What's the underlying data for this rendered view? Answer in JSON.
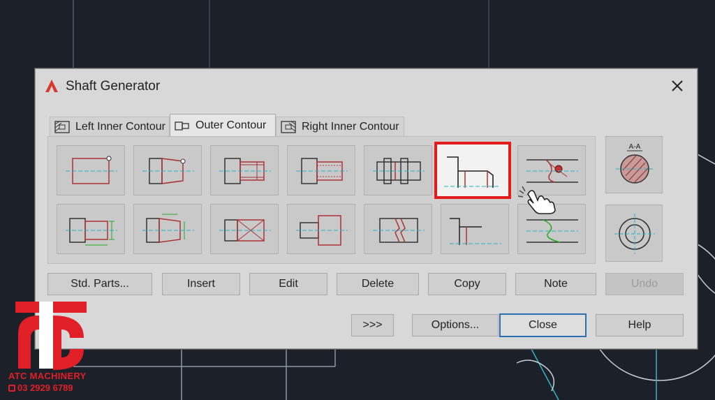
{
  "window": {
    "title": "Shaft Generator"
  },
  "icons": {
    "app": "autocad-a-icon",
    "close": "close-icon",
    "cursor": "hand-pointer-icon"
  },
  "tabs": [
    {
      "label": "Left Inner Contour",
      "active": false
    },
    {
      "label": "Outer Contour",
      "active": true
    },
    {
      "label": "Right Inner Contour",
      "active": false
    }
  ],
  "section_tiles": {
    "row1": [
      "cylinder",
      "cone",
      "cylinder-with-thread",
      "cylinder-with-spline",
      "cylinder-grooved",
      "shoulder-contour",
      "sectional-break"
    ],
    "row2": [
      "cylinder-dimensioned",
      "cone-dimensioned",
      "cross-section",
      "step",
      "broken-shaft",
      "fillet-contour",
      "break-line"
    ],
    "selected": "shoulder-contour"
  },
  "side_tiles": {
    "section_label": "A-A"
  },
  "buttons_row1": {
    "std_parts": "Std. Parts...",
    "insert": "Insert",
    "edit": "Edit",
    "delete": "Delete",
    "copy": "Copy",
    "note": "Note",
    "undo": "Undo"
  },
  "buttons_row2": {
    "expand": ">>>",
    "options": "Options...",
    "close": "Close",
    "help": "Help"
  },
  "watermark": {
    "company": "ATC MACHINERY",
    "phone": "03 2929 6789"
  },
  "colors": {
    "selected_border": "#e21b1b",
    "accent_red": "#c0392b",
    "centerline": "#1fb3c7",
    "focus_blue": "#2b6fb0"
  }
}
